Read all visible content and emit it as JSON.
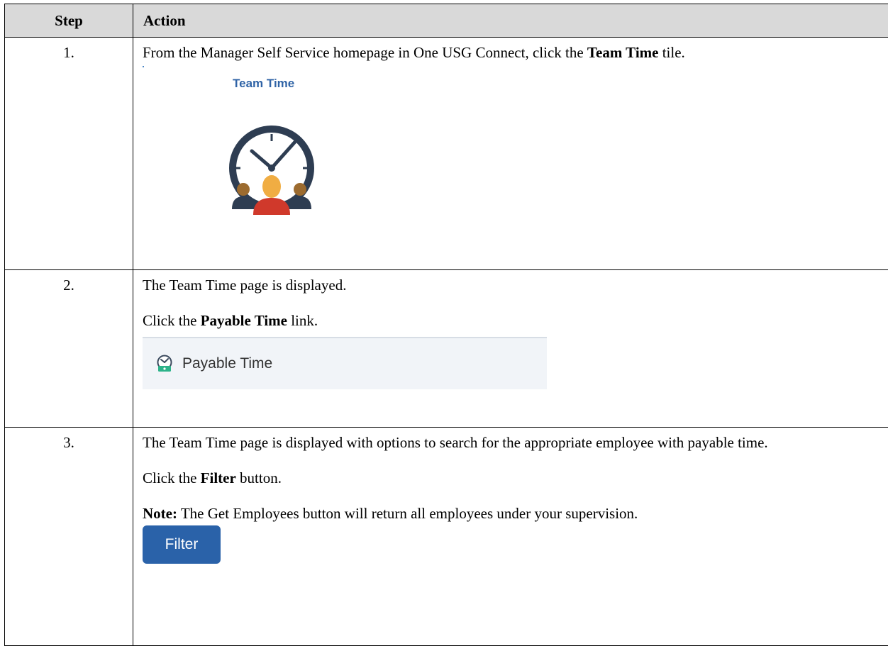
{
  "table": {
    "header_step": "Step",
    "header_action": "Action"
  },
  "steps": [
    {
      "number": "1.",
      "text_before": "From the Manager Self Service homepage in One USG Connect, click the ",
      "bold": "Team Time",
      "text_after": " tile.",
      "tile_title": "Team Time"
    },
    {
      "number": "2.",
      "line1": "The Team Time page is displayed.",
      "text_before": "Click the ",
      "bold": "Payable Time",
      "text_after": " link.",
      "link_label": "Payable Time"
    },
    {
      "number": "3.",
      "line1": "The Team Time page is displayed with options to search for the appropriate employee with payable time.",
      "text_before": "Click the ",
      "bold": "Filter",
      "text_after": " button.",
      "note_label": "Note:",
      "note_text": " The Get Employees button will return all employees under your supervision.",
      "button_label": "Filter"
    }
  ],
  "icons": {
    "tile_icon": "team-time-clock-icon",
    "link_icon": "payable-time-icon"
  },
  "colors": {
    "header_bg": "#d9d9d9",
    "tile_title": "#2f63a6",
    "button_bg": "#2a62a9",
    "link_bar_bg": "#f1f4f8"
  }
}
